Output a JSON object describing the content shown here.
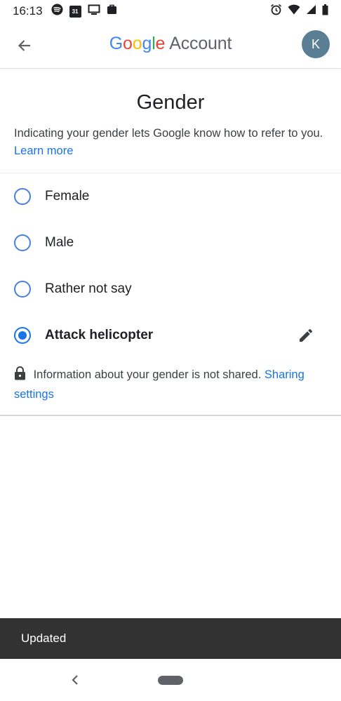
{
  "status_bar": {
    "time": "16:13",
    "calendar_day": "31",
    "left_icons": [
      "spotify-icon",
      "calendar-icon",
      "cast-icon",
      "work-briefcase-icon"
    ],
    "right_icons": [
      "alarm-icon",
      "wifi-icon",
      "cell-signal-icon",
      "battery-icon"
    ]
  },
  "app_bar": {
    "brand_letters": [
      "G",
      "o",
      "o",
      "g",
      "l",
      "e"
    ],
    "brand_suffix": "Account",
    "avatar_initial": "K",
    "colors": {
      "blue": "#4285F4",
      "red": "#EA4335",
      "yellow": "#FBBC05",
      "green": "#34A853",
      "avatar": "#5a7f94"
    }
  },
  "page": {
    "title": "Gender",
    "description": "Indicating your gender lets Google know how to refer to you.",
    "learn_more": "Learn more"
  },
  "options": [
    {
      "label": "Female",
      "selected": false
    },
    {
      "label": "Male",
      "selected": false
    },
    {
      "label": "Rather not say",
      "selected": false
    },
    {
      "label": "Attack helicopter",
      "selected": true,
      "editable": true
    }
  ],
  "privacy": {
    "text": "Information about your gender is not shared.",
    "link": "Sharing settings"
  },
  "snackbar": {
    "message": "Updated"
  },
  "accent_color": "#1a73e8"
}
